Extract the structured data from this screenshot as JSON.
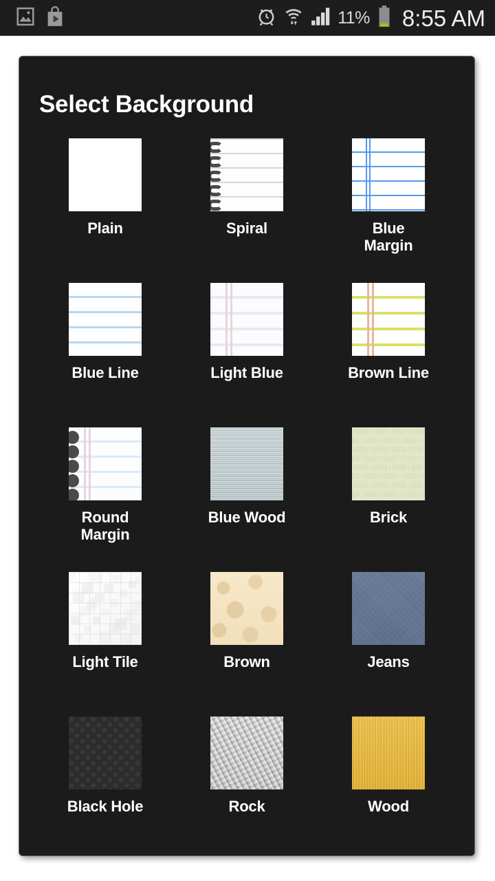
{
  "statusbar": {
    "left_icons": [
      "gallery-icon",
      "play-store-icon"
    ],
    "right_icons": [
      "alarm-icon",
      "wifi-icon",
      "signal-icon",
      "battery-icon"
    ],
    "battery_percent": "11%",
    "clock": "8:55 AM",
    "background_color": "#1d1d1d",
    "text_color": "#e8e8e8",
    "battery_fill_color": "#99cc00"
  },
  "dialog": {
    "title": "Select Background",
    "background_color": "#1b1b1b",
    "title_color": "#ffffff",
    "label_color": "#ffffff"
  },
  "backgrounds": [
    {
      "label": "Plain",
      "icon": "plain-paper-swatch",
      "texture": "tx-plain",
      "colors": [
        "#ffffff"
      ]
    },
    {
      "label": "Spiral",
      "icon": "spiral-notebook-swatch",
      "texture": "tx-spiral",
      "colors": [
        "#fdfdfe",
        "#cfd8e0",
        "#4a4a4a"
      ]
    },
    {
      "label": "Blue Margin",
      "icon": "blue-margin-paper-swatch",
      "texture": "tx-bluemargin",
      "colors": [
        "#ffffff",
        "#5599ee"
      ]
    },
    {
      "label": "Blue Line",
      "icon": "blue-line-paper-swatch",
      "texture": "tx-blueline",
      "colors": [
        "#fdfeff",
        "#b9d6f2"
      ]
    },
    {
      "label": "Light Blue",
      "icon": "light-blue-paper-swatch",
      "texture": "tx-lightblue",
      "colors": [
        "#fcfbfd",
        "#e4ebf2",
        "#e6d6dc"
      ]
    },
    {
      "label": "Brown Line",
      "icon": "brown-line-paper-swatch",
      "texture": "tx-brownline",
      "colors": [
        "#ffffff",
        "#dbe06a",
        "#e8b79b"
      ]
    },
    {
      "label": "Round Margin",
      "icon": "round-margin-swatch",
      "texture": "tx-roundmargin",
      "colors": [
        "#fdfdfe",
        "#dbeaf7",
        "#e7d4da",
        "#4a4a4a"
      ]
    },
    {
      "label": "Blue Wood",
      "icon": "blue-wood-swatch",
      "texture": "tx-bluewood",
      "colors": [
        "#bcc9cc"
      ]
    },
    {
      "label": "Brick",
      "icon": "brick-swatch",
      "texture": "tx-brick",
      "colors": [
        "#dde2c1",
        "#ffffff"
      ]
    },
    {
      "label": "Light Tile",
      "icon": "light-tile-swatch",
      "texture": "tx-lighttile",
      "colors": [
        "#f8f8f8",
        "#e4e4e4"
      ]
    },
    {
      "label": "Brown",
      "icon": "brown-texture-swatch",
      "texture": "tx-brown",
      "colors": [
        "#f5e4c4",
        "#d7b98c"
      ]
    },
    {
      "label": "Jeans",
      "icon": "jeans-denim-swatch",
      "texture": "tx-jeans",
      "colors": [
        "#5d7396"
      ]
    },
    {
      "label": "Black Hole",
      "icon": "black-hole-swatch",
      "texture": "tx-blackhole",
      "colors": [
        "#2c2c2c"
      ]
    },
    {
      "label": "Rock",
      "icon": "rock-texture-swatch",
      "texture": "tx-rock",
      "colors": [
        "#c9c9c9"
      ]
    },
    {
      "label": "Wood",
      "icon": "wood-texture-swatch",
      "texture": "tx-wood",
      "colors": [
        "#e8b93d"
      ]
    }
  ]
}
